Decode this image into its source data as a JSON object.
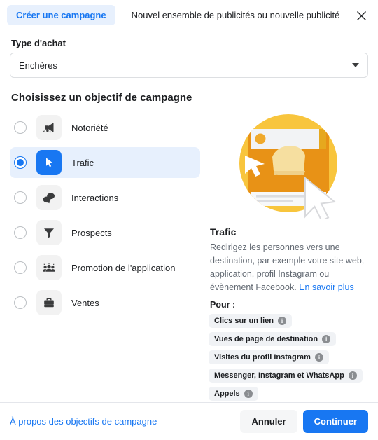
{
  "header": {
    "tab_active": "Créer une campagne",
    "tab_inactive": "Nouvel ensemble de publicités ou nouvelle publicité",
    "close_icon": "close-icon"
  },
  "purchase": {
    "label": "Type d'achat",
    "value": "Enchères"
  },
  "objectives": {
    "section_title": "Choisissez un objectif de campagne",
    "items": [
      {
        "label": "Notoriété",
        "icon": "megaphone-icon",
        "selected": false
      },
      {
        "label": "Trafic",
        "icon": "cursor-icon",
        "selected": true
      },
      {
        "label": "Interactions",
        "icon": "chat-bubbles-icon",
        "selected": false
      },
      {
        "label": "Prospects",
        "icon": "funnel-icon",
        "selected": false
      },
      {
        "label": "Promotion de l'application",
        "icon": "people-group-icon",
        "selected": false
      },
      {
        "label": "Ventes",
        "icon": "briefcase-icon",
        "selected": false
      }
    ]
  },
  "detail": {
    "illustration": "traffic-illustration",
    "title": "Trafic",
    "description": "Redirigez les personnes vers une destination, par exemple votre site web, application, profil Instagram ou évènement Facebook.",
    "learn_more": "En savoir plus",
    "pour_label": "Pour :",
    "chips": [
      "Clics sur un lien",
      "Vues de page de destination",
      "Visites du profil Instagram",
      "Messenger, Instagram et WhatsApp",
      "Appels"
    ]
  },
  "footer": {
    "link": "À propos des objectifs de campagne",
    "cancel": "Annuler",
    "continue": "Continuer"
  },
  "colors": {
    "accent": "#1877F2",
    "accent_soft": "#E7F0FD",
    "tile": "#F2F2F2",
    "chip": "#F0F2F5",
    "illustration_yellow": "#F7C32E",
    "illustration_orange": "#E89216"
  }
}
